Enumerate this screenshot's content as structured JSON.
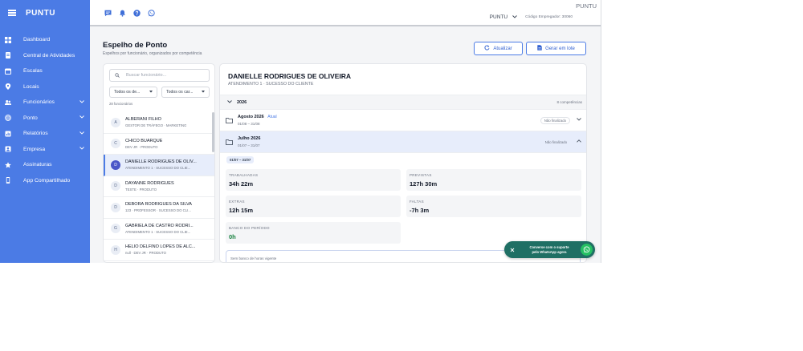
{
  "app": {
    "brand": "PUNTU"
  },
  "sidebar": {
    "items": [
      {
        "label": "Dashboard",
        "icon": "dashboard-icon",
        "has_submenu": false
      },
      {
        "label": "Central de Atividades",
        "icon": "activities-icon",
        "has_submenu": false
      },
      {
        "label": "Escalas",
        "icon": "calendar-icon",
        "has_submenu": false
      },
      {
        "label": "Locais",
        "icon": "location-pin-icon",
        "has_submenu": false
      },
      {
        "label": "Funcionários",
        "icon": "users-icon",
        "has_submenu": true
      },
      {
        "label": "Ponto",
        "icon": "fingerprint-icon",
        "has_submenu": true
      },
      {
        "label": "Relatórios",
        "icon": "reports-icon",
        "has_submenu": true
      },
      {
        "label": "Empresa",
        "icon": "company-icon",
        "has_submenu": true
      },
      {
        "label": "Assinaturas",
        "icon": "star-icon",
        "has_submenu": false
      },
      {
        "label": "App Compartilhado",
        "icon": "phone-icon",
        "has_submenu": false
      }
    ]
  },
  "topbar": {
    "company_corner": "PUNTU",
    "company_name": "PUNTU",
    "employer_code": "Código Empregador: 30060"
  },
  "page": {
    "title": "Espelho de Ponto",
    "subtitle": "Espelhos por funcionário, organizados por competência",
    "update_button": "Atualizar",
    "batch_button": "Gerar em lote"
  },
  "employee_list": {
    "search_placeholder": "Buscar funcionário...",
    "filter_department": "Todos os de...",
    "filter_role": "Todos os car...",
    "count_label": "28 funcionários",
    "employees": [
      {
        "initial": "A",
        "name": "ALBERANI FILHO",
        "subtitle": "GESTOR DE TRÁFEGO · MARKETING",
        "selected": false
      },
      {
        "initial": "C",
        "name": "CHICO BUARQUE",
        "subtitle": "DEV JR · PRODUTO",
        "selected": false
      },
      {
        "initial": "D",
        "name": "DANIELLE RODRIGUES DE OLIV...",
        "subtitle": "ATENDIMENTO 1 · SUCESSO DO CLIE...",
        "selected": true
      },
      {
        "initial": "D",
        "name": "DAYANNE RODRIGUES",
        "subtitle": "TESTE · PRODUTO",
        "selected": false
      },
      {
        "initial": "D",
        "name": "DÉBORA RODRIGUES DA SILVA",
        "subtitle": "123 · PROFESSOR · SUCESSO DO CLI...",
        "selected": false
      },
      {
        "initial": "G",
        "name": "GABRIELA DE CASTRO RODRI...",
        "subtitle": "ATENDIMENTO 1 · SUCESSO DO CLIE...",
        "selected": false
      },
      {
        "initial": "H",
        "name": "HÉLIO DELFINO LOPES DE ALC...",
        "subtitle": "null · DEV JR · PRODUTO",
        "selected": false
      }
    ]
  },
  "detail": {
    "employee_name": "DANIELLE RODRIGUES DE OLIVEIRA",
    "employee_subtitle": "ATENDIMENTO 1 · SUCESSO DO CLIENTE",
    "year": "2026",
    "year_count": "8 competências",
    "months": [
      {
        "title": "Agosto 2026",
        "tag": "Atual",
        "range": "01/08 – 31/08",
        "status": "Não finalizado",
        "expanded": false
      },
      {
        "title": "Julho 2026",
        "tag": "",
        "range": "01/07 – 31/07",
        "status": "Não finalizado",
        "expanded": true
      }
    ],
    "period_chip": "01/07 – 31/07",
    "stats": {
      "worked_label": "TRABALHADAS",
      "worked_value": "34h 22m",
      "expected_label": "PREVISTAS",
      "expected_value": "127h 30m",
      "extra_label": "EXTRAS",
      "extra_value": "12h 15m",
      "missing_label": "FALTAS",
      "missing_value": "-7h 3m",
      "bank_label": "BANCO DO PERÍODO",
      "bank_value": "0h"
    },
    "note": "Sem banco de horas vigente"
  },
  "whatsapp": {
    "line1": "Converse com o suporte",
    "line2": "pelo WhatsApp agora"
  },
  "colors": {
    "accent": "#4b7be5",
    "whatsapp": "#25c063",
    "bank_positive": "#15803d"
  }
}
